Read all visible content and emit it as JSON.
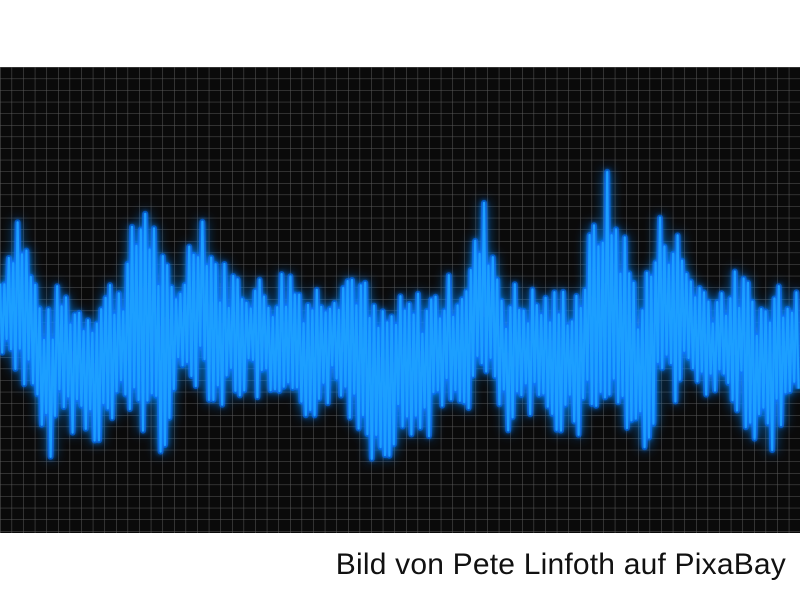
{
  "image": {
    "subject": "audio-waveform",
    "grid_color": "#5a5a5a",
    "background_color": "#0a0a0a",
    "wave_color": "#1a9fff",
    "wave_glow_color": "#0b6cff"
  },
  "caption": {
    "text": "Bild von Pete Linfoth auf PixaBay"
  }
}
